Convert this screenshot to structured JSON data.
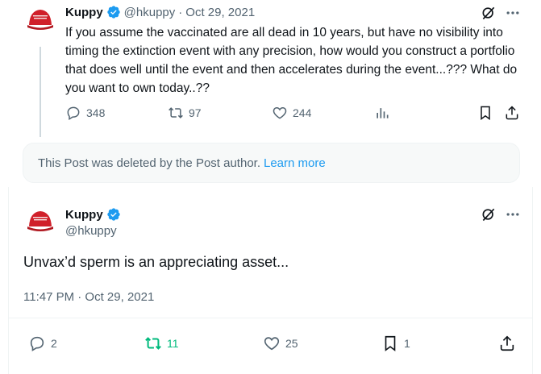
{
  "first_tweet": {
    "display_name": "Kuppy",
    "handle": "@hkuppy",
    "separator": "·",
    "date": "Oct 29, 2021",
    "text": "If you assume the vaccinated are all dead in 10 years, but have no visibility into timing the extinction event with any precision, how would you construct a portfolio that does well until the event and then accelerates during the event...??? What do you want to own today..??",
    "replies": "348",
    "reposts": "97",
    "likes": "244"
  },
  "deleted_notice": {
    "text": "This Post was deleted by the Post author.",
    "link": "Learn more"
  },
  "main_tweet": {
    "display_name": "Kuppy",
    "handle": "@hkuppy",
    "text": "Unvax’d sperm is an appreciating asset...",
    "timestamp": "11:47 PM · Oct 29, 2021",
    "replies": "2",
    "reposts": "11",
    "likes": "25",
    "bookmarks": "1"
  },
  "colors": {
    "verified": "#1d9bf0",
    "repost_active": "#00ba7c",
    "muted": "#536471",
    "avatar_red": "#d0202a"
  },
  "icons": [
    "verified-badge-icon",
    "grok-icon",
    "more-icon",
    "reply-icon",
    "repost-icon",
    "like-icon",
    "views-icon",
    "bookmark-icon",
    "share-icon"
  ]
}
